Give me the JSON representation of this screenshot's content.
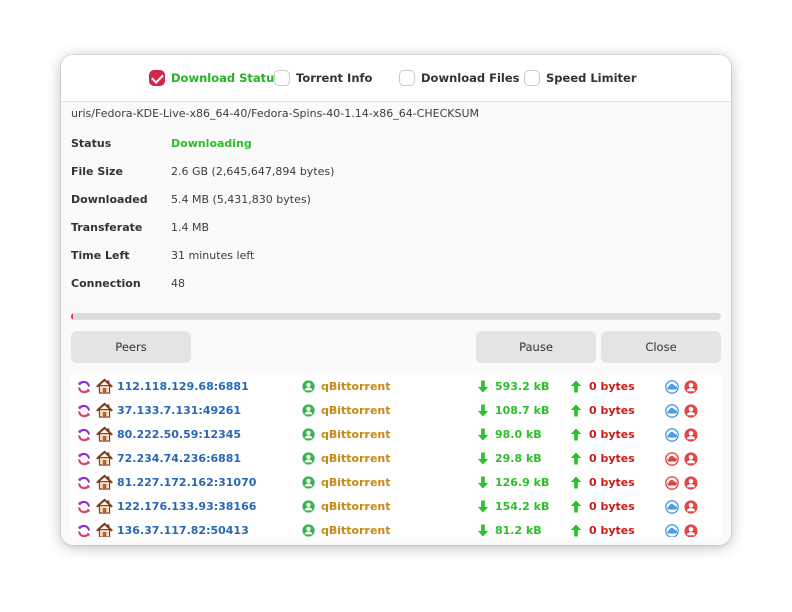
{
  "tabs": [
    {
      "label": "Download Status",
      "checked": true
    },
    {
      "label": "Torrent Info",
      "checked": false
    },
    {
      "label": "Download Files",
      "checked": false
    },
    {
      "label": "Speed Limiter",
      "checked": false
    }
  ],
  "uri": "uris/Fedora-KDE-Live-x86_64-40/Fedora-Spins-40-1.14-x86_64-CHECKSUM",
  "info": [
    {
      "label": "Status",
      "value": "Downloading"
    },
    {
      "label": "File Size",
      "value": "2.6 GB (2,645,647,894 bytes)"
    },
    {
      "label": "Downloaded",
      "value": "5.4 MB (5,431,830 bytes)"
    },
    {
      "label": "Transferate",
      "value": "1.4 MB"
    },
    {
      "label": "Time Left",
      "value": "31 minutes left"
    },
    {
      "label": "Connection",
      "value": "48"
    }
  ],
  "progress": {
    "fraction": 0.002
  },
  "buttons": {
    "peers": "Peers",
    "pause": "Pause",
    "close": "Close"
  },
  "colors": {
    "accent": "#d3264b",
    "active_tab": "#24b324",
    "address": "#2667b8",
    "client": "#c68a10",
    "download_speed": "#2bbf2b",
    "upload_speed": "#cc1a1a",
    "status_blue": "#4a9de0",
    "status_red": "#e04848"
  },
  "peers": [
    {
      "address": "112.118.129.68:6881",
      "client": "qBittorrent",
      "download": "593.2 kB",
      "upload": "0 bytes",
      "status_icons": [
        "cloud-icon",
        "user-red-icon"
      ]
    },
    {
      "address": "37.133.7.131:49261",
      "client": "qBittorrent",
      "download": "108.7 kB",
      "upload": "0 bytes",
      "status_icons": [
        "cloud-icon",
        "user-red-icon"
      ]
    },
    {
      "address": "80.222.50.59:12345",
      "client": "qBittorrent",
      "download": "98.0 kB",
      "upload": "0 bytes",
      "status_icons": [
        "cloud-icon",
        "user-red-icon"
      ]
    },
    {
      "address": "72.234.74.236:6881",
      "client": "qBittorrent",
      "download": "29.8 kB",
      "upload": "0 bytes",
      "status_icons": [
        "cloud-red-icon",
        "user-red-icon"
      ]
    },
    {
      "address": "81.227.172.162:31070",
      "client": "qBittorrent",
      "download": "126.9 kB",
      "upload": "0 bytes",
      "status_icons": [
        "cloud-red-icon",
        "user-red-icon"
      ]
    },
    {
      "address": "122.176.133.93:38166",
      "client": "qBittorrent",
      "download": "154.2 kB",
      "upload": "0 bytes",
      "status_icons": [
        "cloud-icon",
        "user-red-icon"
      ]
    },
    {
      "address": "136.37.117.82:50413",
      "client": "qBittorrent",
      "download": "81.2 kB",
      "upload": "0 bytes",
      "status_icons": [
        "cloud-icon",
        "user-red-icon"
      ]
    }
  ]
}
